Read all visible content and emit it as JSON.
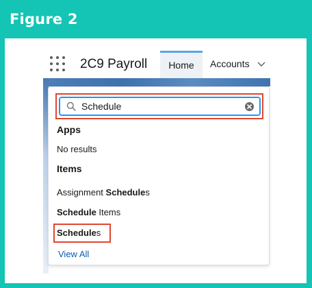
{
  "figure": {
    "title": "Figure 2"
  },
  "header": {
    "app_name": "2C9 Payroll",
    "tabs": [
      {
        "label": "Home",
        "active": true
      },
      {
        "label": "Accounts",
        "has_menu": true
      }
    ]
  },
  "search": {
    "value": "Schedule",
    "icon": "search-icon",
    "clear_icon": "clear-icon"
  },
  "results": {
    "apps_heading": "Apps",
    "apps_empty": "No results",
    "items_heading": "Items",
    "items": [
      {
        "prefix": "Assignment ",
        "bold": "Schedule",
        "suffix": "s"
      },
      {
        "prefix": "",
        "bold": "Schedule",
        "suffix": " Items"
      },
      {
        "prefix": "",
        "bold": "Schedule",
        "suffix": "s"
      }
    ],
    "view_all": "View All"
  },
  "colors": {
    "frame": "#14c4b4",
    "highlight": "#e0452e",
    "link": "#0b5cab",
    "focus": "#1b96ff"
  }
}
